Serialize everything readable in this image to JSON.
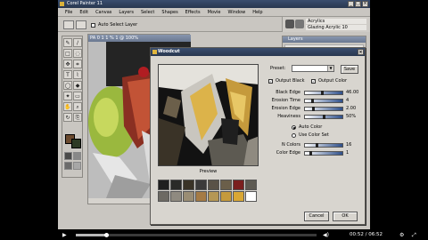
{
  "app": {
    "title": "Corel Painter 11",
    "window_buttons": [
      "_",
      "□",
      "×"
    ]
  },
  "menu": [
    "File",
    "Edit",
    "Canvas",
    "Layers",
    "Select",
    "Shapes",
    "Effects",
    "Movie",
    "Window",
    "Help"
  ],
  "property_bar": {
    "auto_select_label": "Auto Select Layer"
  },
  "brush_selector": {
    "category": "Acrylics",
    "variant": "Glazing Acrylic 10"
  },
  "layers_panel": {
    "title": "Layers",
    "rows": [
      "",
      "",
      ""
    ]
  },
  "document": {
    "title": "PA 0 1 1 % 1 @ 100%"
  },
  "dialog": {
    "title": "Woodcut",
    "preset_label": "Preset:",
    "preset_value": "",
    "save_label": "Save",
    "output_black_label": "Output Black",
    "output_color_label": "Output Color",
    "sliders": [
      {
        "label": "Black Edge",
        "value": "46.00",
        "fraction": 0.46
      },
      {
        "label": "Erosion Time",
        "value": "4",
        "fraction": 0.18
      },
      {
        "label": "Erosion Edge",
        "value": "2.00",
        "fraction": 0.2
      },
      {
        "label": "Heaviness",
        "value": "50%",
        "fraction": 0.5
      }
    ],
    "auto_color_label": "Auto Color",
    "use_color_set_label": "Use Color Set",
    "n_colors_label": "N Colors",
    "n_colors_value": "16",
    "n_colors_fraction": 0.3,
    "color_edge_label": "Color Edge",
    "color_edge_value": "1",
    "color_edge_fraction": 0.12,
    "preview_label": "Preview",
    "palette": [
      "#1f1f1f",
      "#2a2a28",
      "#3a3327",
      "#3b3a3a",
      "#5a5247",
      "#6b5f4a",
      "#7a1f1f",
      "#5d5a52",
      "#6d6a63",
      "#8f8a80",
      "#9a8d74",
      "#a57b45",
      "#b59754",
      "#c59a3c",
      "#d9a734",
      "#ffffff"
    ],
    "cancel_label": "Cancel",
    "ok_label": "OK"
  },
  "player": {
    "time": "00:52 / 06:52",
    "progress": 0.126
  }
}
